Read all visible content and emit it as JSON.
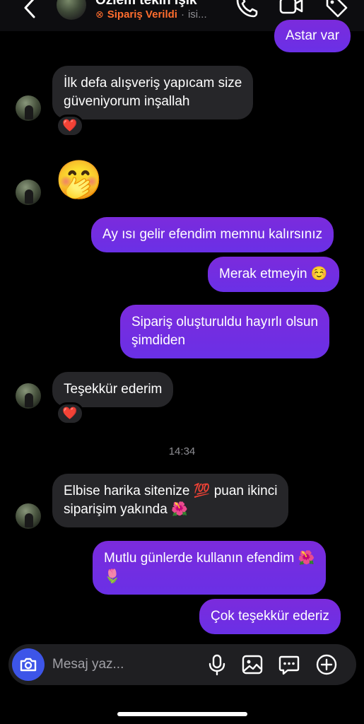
{
  "header": {
    "contact_name": "Özlem tekin Işık",
    "status_label": "Sipariş Verildi",
    "status_separator": "·",
    "status_extra": "isi...",
    "status_icon": "order-status-icon",
    "status_color": "#ff6d2e"
  },
  "messages": {
    "m0": {
      "text": "Astar var",
      "direction": "outgoing"
    },
    "m1": {
      "line1": "İlk defa alışveriş yapıcam size",
      "line2": "güveniyorum inşallah",
      "direction": "incoming",
      "reaction": "❤️"
    },
    "m2": {
      "emoji": "🤭",
      "direction": "incoming"
    },
    "m3": {
      "text": "Ay ısı gelir efendim memnu kalırsınız",
      "direction": "outgoing"
    },
    "m4": {
      "text": "Merak etmeyin ☺️",
      "direction": "outgoing"
    },
    "m5": {
      "line1": "Sipariş oluşturuldu hayırlı olsun",
      "line2": "şimdiden",
      "direction": "outgoing"
    },
    "m6": {
      "text": "Teşekkür ederim",
      "direction": "incoming",
      "reaction": "❤️"
    },
    "timestamp": "14:34",
    "m7": {
      "line1": "Elbise harika  sitenize 💯 puan ikinci",
      "line2": "siparişim yakında 🌺",
      "direction": "incoming"
    },
    "m8": {
      "line1": "Mutlu günlerde kullanın efendim 🌺",
      "line2": "🌷",
      "direction": "outgoing"
    },
    "m9": {
      "text": "Çok teşekkür ederiz",
      "direction": "outgoing"
    }
  },
  "composer": {
    "placeholder": "Mesaj yaz...",
    "icons": [
      "camera-icon",
      "microphone-icon",
      "gallery-icon",
      "sticker-icon",
      "add-icon"
    ]
  },
  "colors": {
    "background": "#000000",
    "incoming_bubble": "#262629",
    "outgoing_bubble": "#7b2bdc",
    "camera_button": "#3d55e8"
  }
}
